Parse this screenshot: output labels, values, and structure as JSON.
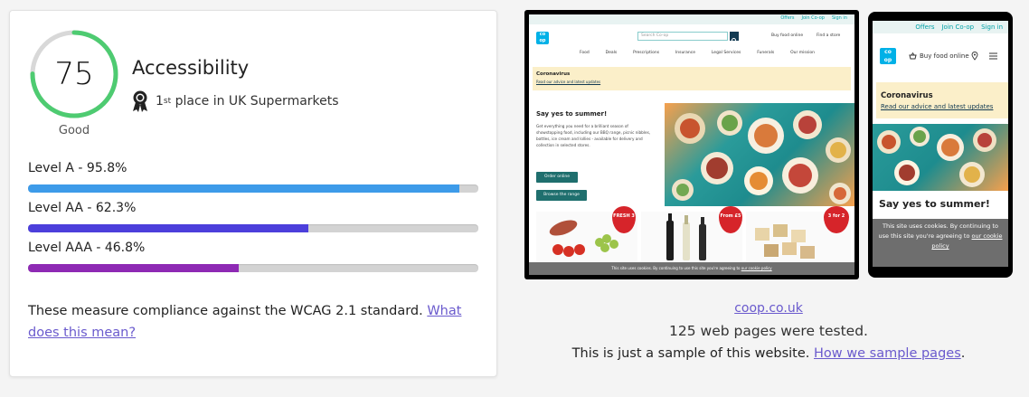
{
  "score": {
    "value": 75,
    "fraction": 0.75,
    "grade": "Good",
    "ring_color": "#4ecb71",
    "track_color": "#d8d8d8"
  },
  "category": {
    "title": "Accessibility",
    "rank_number": "1",
    "rank_suffix": "st",
    "rank_text": " place in UK Supermarkets"
  },
  "levels": [
    {
      "label": "Level A - 95.8%",
      "percent": 95.8,
      "color": "#3d9be9"
    },
    {
      "label": "Level AA - 62.3%",
      "percent": 62.3,
      "color": "#4c3fdb"
    },
    {
      "label": "Level AAA - 46.8%",
      "percent": 46.8,
      "color": "#8e2ab4"
    }
  ],
  "note": {
    "text": "These measure compliance against the WCAG 2.1 standard. ",
    "link": "What does this mean?"
  },
  "desktop_preview": {
    "top_links": [
      "Offers",
      "Join Co-op",
      "Sign in"
    ],
    "logo": "co op",
    "search_placeholder": "Search Co-op",
    "buy_food": "Buy food online",
    "find_store": "Find a store",
    "nav": [
      "Food",
      "Deals",
      "Prescriptions",
      "Insurance",
      "Legal Services",
      "Funerals",
      "Our mission"
    ],
    "banner_title": "Coronavirus",
    "banner_link": "Read our advice and latest updates",
    "hero_title": "Say yes to summer!",
    "hero_text": "Get everything you need for a brilliant season of showstopping food, including our BBQ range, picnic nibbles, bottles, ice cream and lollies - available for delivery and collection in selected stores.",
    "btn_order": "Order online",
    "btn_browse": "Browse the range",
    "badge1": "FRESH 3",
    "badge2": "From £5",
    "badge3": "3 for 2",
    "cookie": "This site uses cookies. By continuing to use this site you're agreeing to",
    "cookie_link": "our cookie policy"
  },
  "mobile_preview": {
    "top_links": [
      "Offers",
      "Join Co-op",
      "Sign in"
    ],
    "logo": "co op",
    "buy_food": "Buy food online",
    "banner_title": "Coronavirus",
    "banner_link": "Read our advice and latest updates",
    "hero_title": "Say yes to summer!",
    "cookie": "This site uses cookies. By continuing to use this site you're agreeing to",
    "cookie_link": "our cookie policy"
  },
  "site": {
    "url": "coop.co.uk",
    "tested": "125 web pages were tested.",
    "sample_text": "This is just a sample of this website. ",
    "sample_link": "How we sample pages",
    "sample_end": "."
  }
}
